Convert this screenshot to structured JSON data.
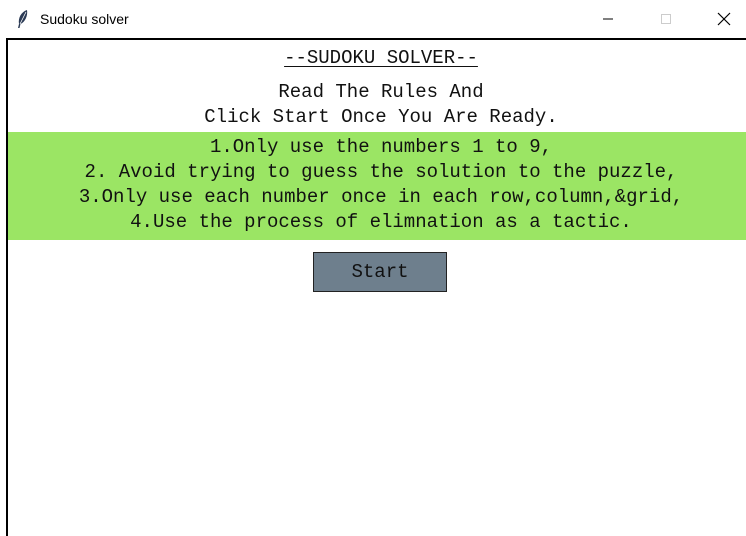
{
  "window": {
    "title": "Sudoku solver",
    "icon": "feather-icon",
    "controls": {
      "minimize": "minimize-icon",
      "maximize": "maximize-icon",
      "close": "close-icon"
    }
  },
  "header": {
    "title": "--SUDOKU SOLVER--",
    "intro_line_1": "Read The Rules And",
    "intro_line_2": "Click Start Once You Are Ready."
  },
  "rules": {
    "background_color": "#9be564",
    "items": [
      "1.Only use the numbers 1 to 9,",
      "2. Avoid trying to guess the solution to the puzzle,",
      "3.Only use each number once in each row,column,&grid,",
      "4.Use the process of elimnation as a tactic."
    ]
  },
  "actions": {
    "start_label": "Start",
    "start_color": "#6e7f8d"
  }
}
